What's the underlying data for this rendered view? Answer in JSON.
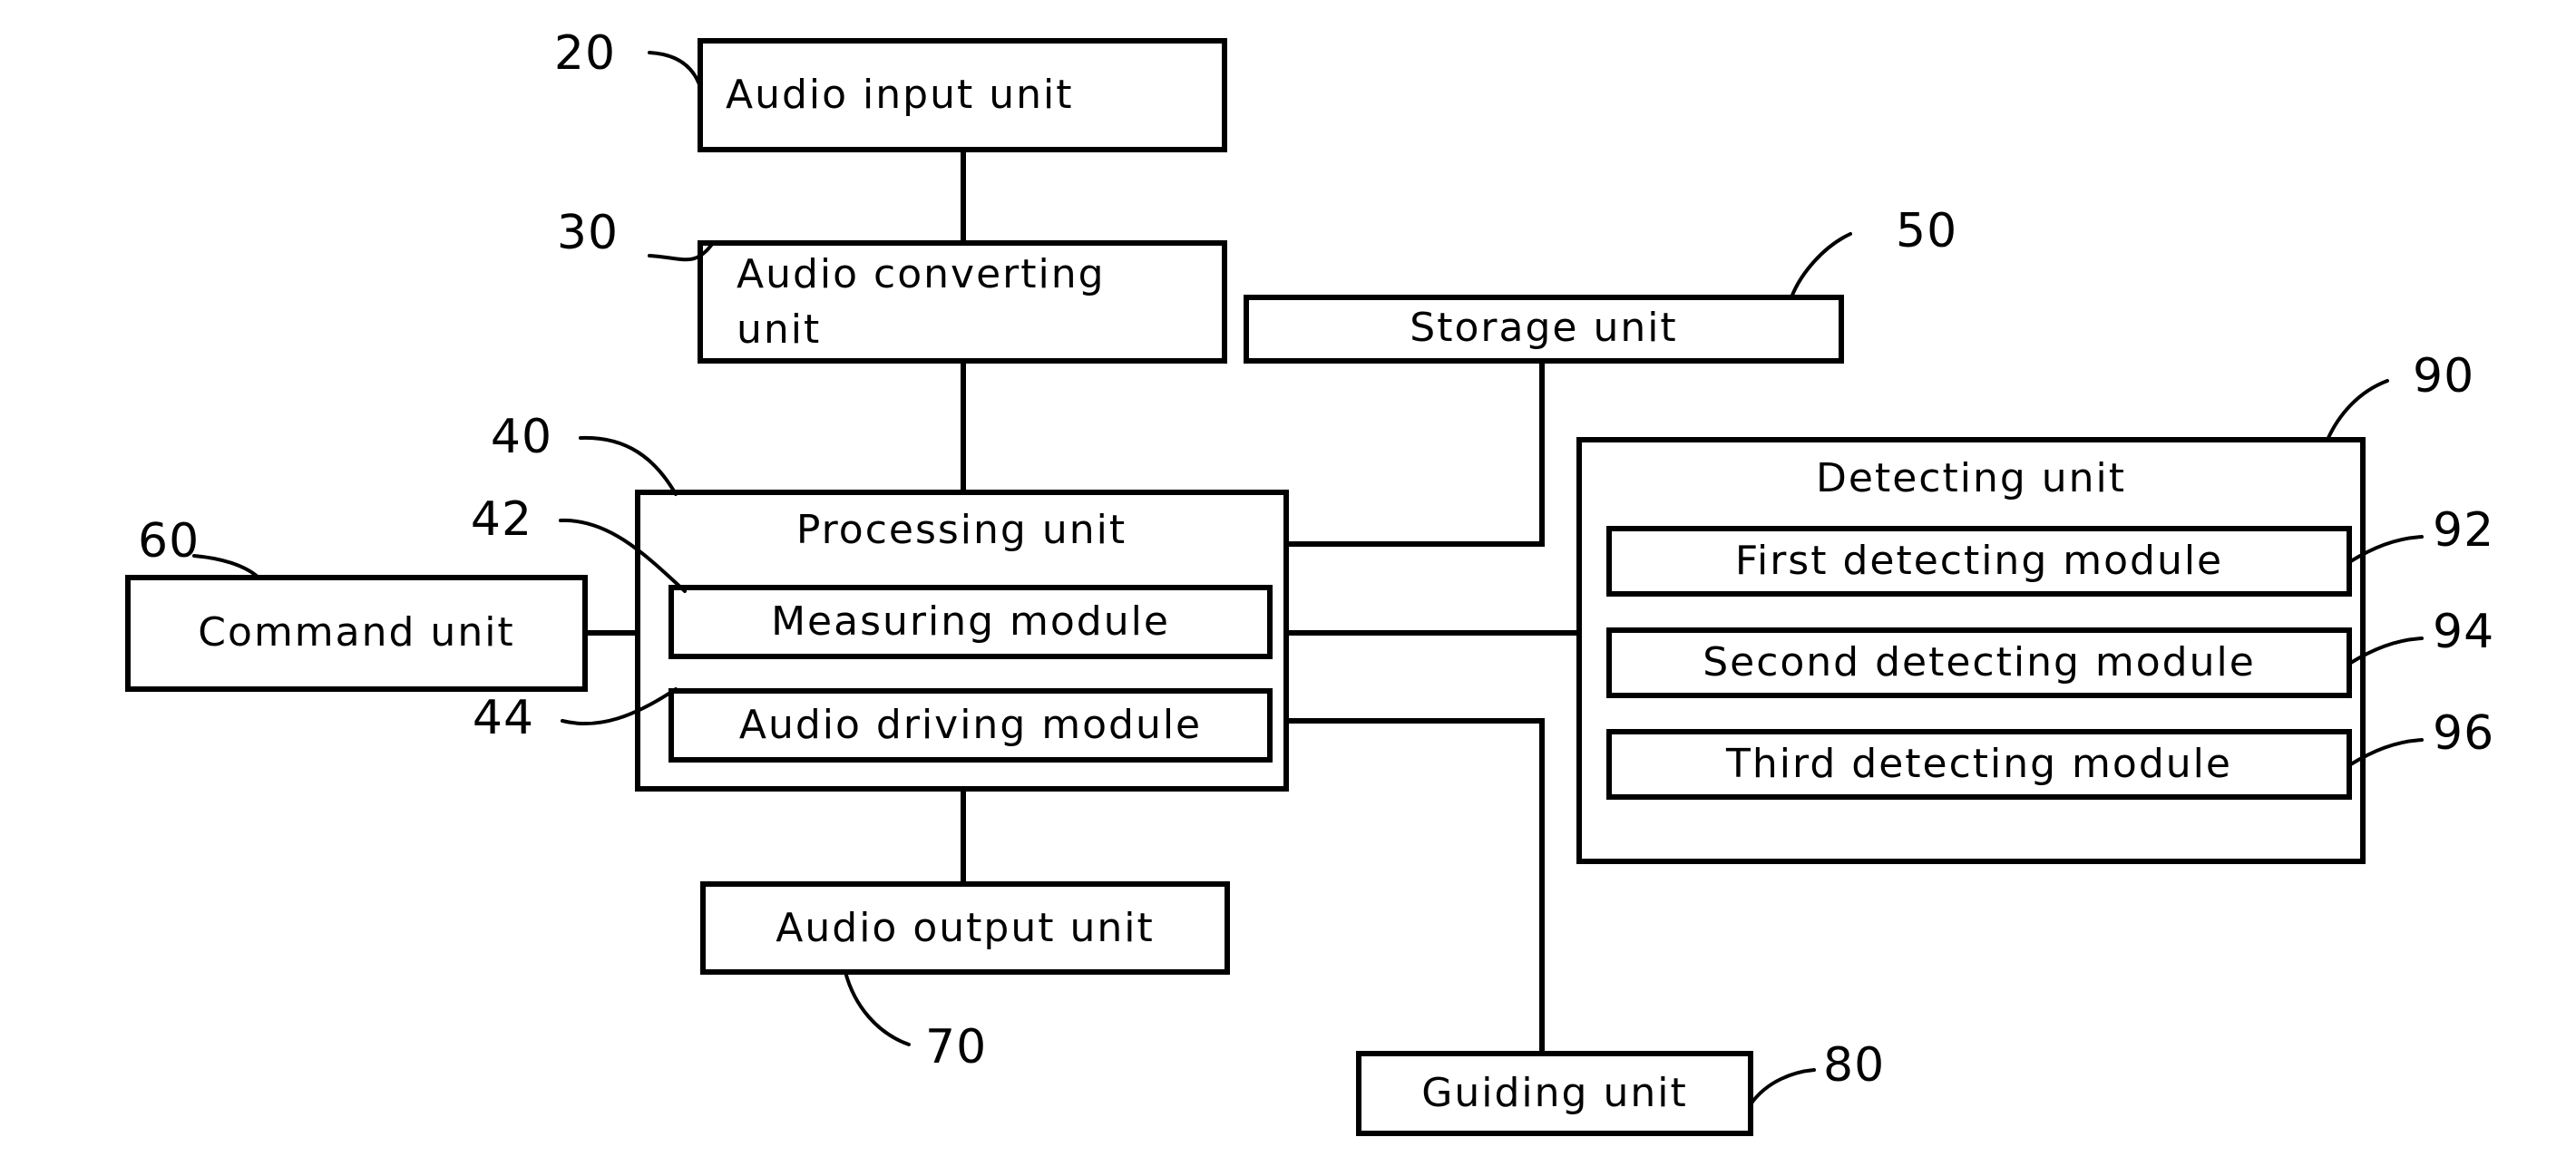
{
  "figure": {
    "type": "patent-block-diagram",
    "background_color": "#ffffff",
    "line_color": "#000000"
  },
  "blocks": {
    "audio_input": {
      "label": "Audio  input  unit",
      "ref": "20"
    },
    "audio_converting": {
      "label_line1": "Audio  converting",
      "label_line2": "unit",
      "ref": "30"
    },
    "storage": {
      "label": "Storage  unit",
      "ref": "50"
    },
    "processing": {
      "label": "Processing  unit",
      "ref": "40"
    },
    "measuring_module": {
      "label": "Measuring  module",
      "ref": "42"
    },
    "audio_driving_module": {
      "label": "Audio  driving  module",
      "ref": "44"
    },
    "command": {
      "label": "Command  unit",
      "ref": "60"
    },
    "audio_output": {
      "label": "Audio  output  unit",
      "ref": "70"
    },
    "guiding": {
      "label": "Guiding  unit",
      "ref": "80"
    },
    "detecting": {
      "label": "Detecting  unit",
      "ref": "90"
    },
    "first_detecting_module": {
      "label": "First  detecting  module",
      "ref": "92"
    },
    "second_detecting_module": {
      "label": "Second  detecting  module",
      "ref": "94"
    },
    "third_detecting_module": {
      "label": "Third  detecting  module",
      "ref": "96"
    }
  }
}
